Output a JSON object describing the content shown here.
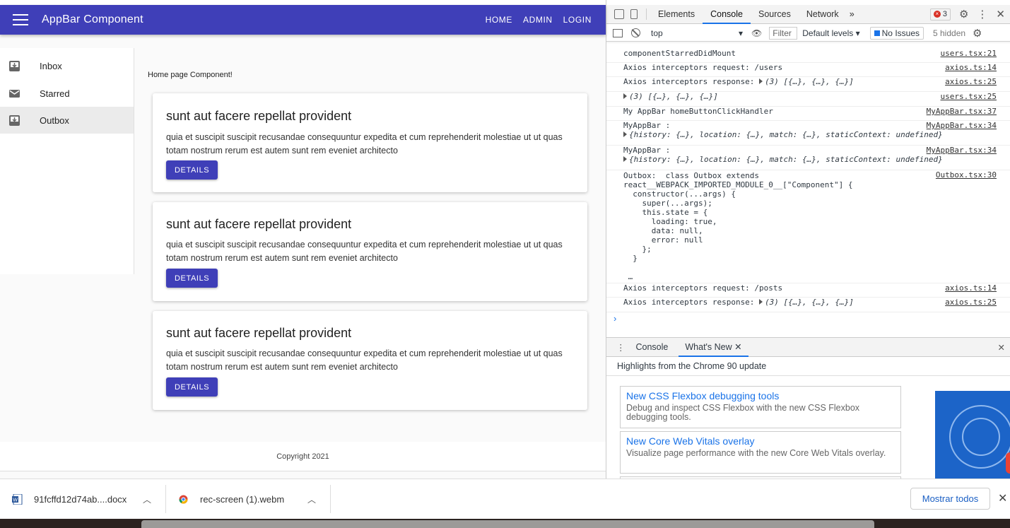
{
  "app": {
    "title": "AppBar Component",
    "nav": [
      "HOME",
      "ADMIN",
      "LOGIN"
    ],
    "sidebar": [
      {
        "label": "Inbox",
        "icon": "inbox-icon"
      },
      {
        "label": "Starred",
        "icon": "mail-icon"
      },
      {
        "label": "Outbox",
        "icon": "outbox-icon"
      }
    ],
    "main_text": "Home page Component!",
    "cards": [
      {
        "title": "sunt aut facere repellat provident",
        "body": "quia et suscipit suscipit recusandae consequuntur expedita et cum reprehenderit molestiae ut ut quas totam nostrum rerum est autem sunt rem eveniet architecto",
        "button": "DETAILS"
      },
      {
        "title": "sunt aut facere repellat provident",
        "body": "quia et suscipit suscipit recusandae consequuntur expedita et cum reprehenderit molestiae ut ut quas totam nostrum rerum est autem sunt rem eveniet architecto",
        "button": "DETAILS"
      },
      {
        "title": "sunt aut facere repellat provident",
        "body": "quia et suscipit suscipit recusandae consequuntur expedita et cum reprehenderit molestiae ut ut quas totam nostrum rerum est autem sunt rem eveniet architecto",
        "button": "DETAILS"
      }
    ],
    "footer": "Copyright 2021",
    "colors": {
      "primary": "#3f3fb8"
    }
  },
  "devtools": {
    "tabs": [
      "Elements",
      "Console",
      "Sources",
      "Network"
    ],
    "more_tabs": "»",
    "error_count": "3",
    "context": "top",
    "filter_placeholder": "Filter",
    "levels": "Default levels ▾",
    "no_issues": "No Issues",
    "hidden": "5 hidden",
    "logs": [
      {
        "msg": "componentStarredDidMount",
        "src": "users.tsx:21"
      },
      {
        "msg": "Axios interceptors request: /users",
        "src": "axios.ts:14"
      },
      {
        "msg": "Axios interceptors response: ",
        "obj": "(3) [{…}, {…}, {…}]",
        "src": "axios.ts:25"
      },
      {
        "msg": "",
        "obj": "(3) [{…}, {…}, {…}]",
        "src": "users.tsx:25"
      },
      {
        "msg": "My AppBar homeButtonClickHandler",
        "src": "MyAppBar.tsx:37"
      },
      {
        "msg": "MyAppBar :",
        "obj": "{history: {…}, location: {…}, match: {…}, staticContext: undefined}",
        "src": "MyAppBar.tsx:34"
      },
      {
        "msg": "MyAppBar :",
        "obj": "{history: {…}, location: {…}, match: {…}, staticContext: undefined}",
        "src": "MyAppBar.tsx:34"
      },
      {
        "msg": "Outbox:  class Outbox extends\nreact__WEBPACK_IMPORTED_MODULE_0__[\"Component\"] {\n  constructor(...args) {\n    super(...args);\n    this.state = {\n      loading: true,\n      data: null,\n      error: null\n    };\n  }\n\n …",
        "src": "Outbox.tsx:30"
      },
      {
        "msg": "Axios interceptors request: /posts",
        "src": "axios.ts:14"
      },
      {
        "msg": "Axios interceptors response: ",
        "obj": "(3) [{…}, {…}, {…}]",
        "src": "axios.ts:25"
      }
    ],
    "prompt": "›",
    "drawer": {
      "tabs": [
        "Console",
        "What's New"
      ],
      "highlights": "Highlights from the Chrome 90 update",
      "items": [
        {
          "title": "New CSS Flexbox debugging tools",
          "desc": "Debug and inspect CSS Flexbox with the new CSS Flexbox debugging tools."
        },
        {
          "title": "New Core Web Vitals overlay",
          "desc": "Visualize page performance with the new Core Web Vitals overlay."
        }
      ]
    }
  },
  "downloads": {
    "items": [
      {
        "name": "91fcffd12d74ab....docx",
        "icon": "word-doc-icon"
      },
      {
        "name": "rec-screen (1).webm",
        "icon": "chrome-file-icon"
      }
    ],
    "show_all": "Mostrar todos"
  }
}
